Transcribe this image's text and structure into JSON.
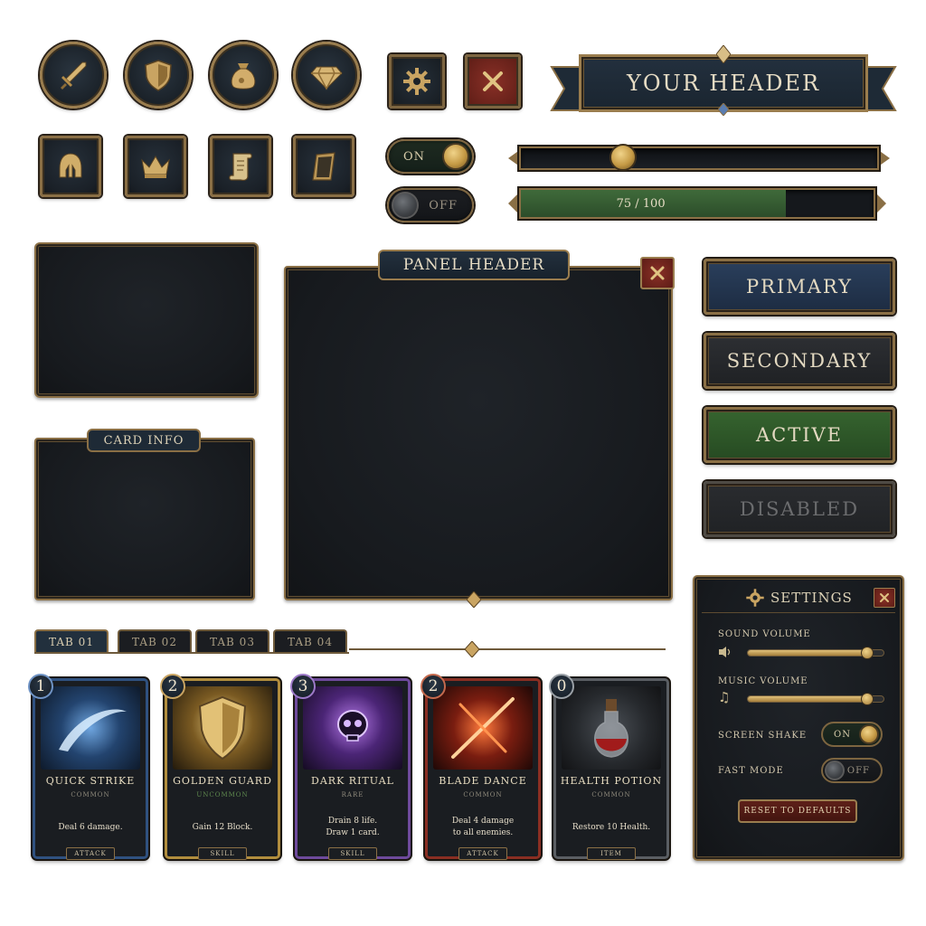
{
  "header": {
    "title": "YOUR HEADER"
  },
  "toggles": {
    "on_label": "ON",
    "off_label": "OFF"
  },
  "slider": {
    "value": 0.29
  },
  "progress": {
    "label": "75 / 100",
    "value": 75,
    "max": 100
  },
  "panels": {
    "card_info": "CARD INFO",
    "panel_header": "PANEL HEADER"
  },
  "buttons": {
    "primary": "PRIMARY",
    "secondary": "SECONDARY",
    "active": "ACTIVE",
    "disabled": "DISABLED"
  },
  "tabs": [
    "TAB 01",
    "TAB 02",
    "TAB 03",
    "TAB 04"
  ],
  "cards": [
    {
      "cost": "1",
      "name": "QUICK STRIKE",
      "rarity": "COMMON",
      "desc": "Deal 6 damage.",
      "type": "ATTACK",
      "border": "#2f5180"
    },
    {
      "cost": "2",
      "name": "GOLDEN GUARD",
      "rarity": "UNCOMMON",
      "desc": "Gain 12 Block.",
      "type": "SKILL",
      "border": "#b18d3d"
    },
    {
      "cost": "3",
      "name": "DARK RITUAL",
      "rarity": "RARE",
      "desc": "Drain 8 life.\nDraw 1 card.",
      "type": "SKILL",
      "border": "#6e4a9c"
    },
    {
      "cost": "2",
      "name": "BLADE DANCE",
      "rarity": "COMMON",
      "desc": "Deal 4 damage\nto all enemies.",
      "type": "ATTACK",
      "border": "#8a2e22"
    },
    {
      "cost": "0",
      "name": "HEALTH POTION",
      "rarity": "COMMON",
      "desc": "Restore 10 Health.",
      "type": "ITEM",
      "border": "#5a5e63"
    }
  ],
  "settings": {
    "title": "SETTINGS",
    "sound_volume": "SOUND VOLUME",
    "sound_value": 0.88,
    "music_volume": "MUSIC VOLUME",
    "music_value": 0.88,
    "screen_shake": "SCREEN SHAKE",
    "screen_shake_state": "ON",
    "fast_mode": "FAST MODE",
    "fast_mode_state": "OFF",
    "reset": "RESET TO DEFAULTS"
  },
  "icons": {
    "round": [
      "sword-icon",
      "shield-icon",
      "coin-bag-icon",
      "gem-icon"
    ],
    "square": [
      "helmet-icon",
      "crown-icon",
      "scroll-icon",
      "book-icon"
    ]
  },
  "colors": {
    "gold": "#9a7d4e",
    "primary": "#22354f",
    "secondary": "#26282b",
    "active": "#2f5a2c",
    "disabled": "#2a2c2f",
    "close_red": "#7a2a22"
  }
}
